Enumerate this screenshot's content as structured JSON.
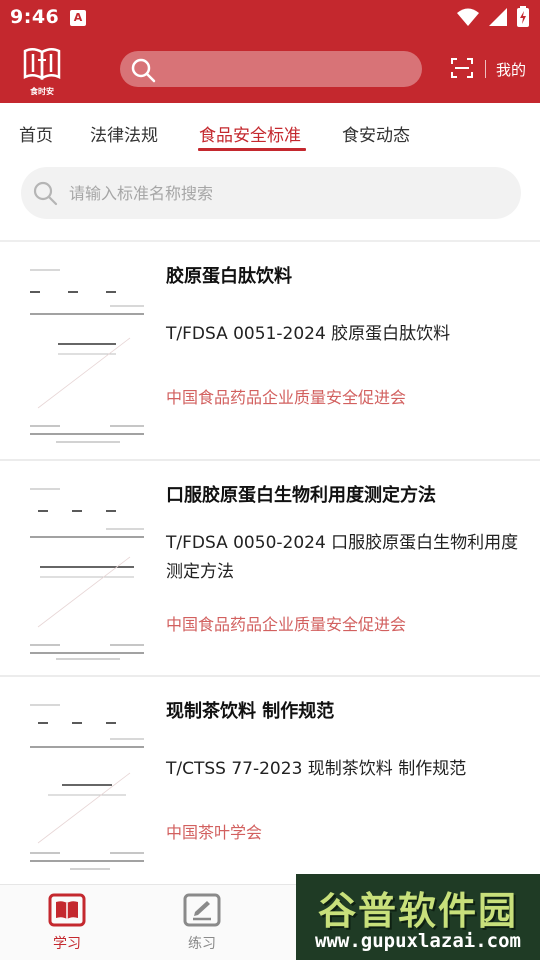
{
  "status_bar": {
    "time": "9:46",
    "notification_icon": "A"
  },
  "app_bar": {
    "logo_text": "食时安",
    "mine_label": "我的"
  },
  "tabs": [
    {
      "label": "首页"
    },
    {
      "label": "法律法规"
    },
    {
      "label": "食品安全标准"
    },
    {
      "label": "食安动态"
    }
  ],
  "active_tab": "食品安全标准",
  "standard_search": {
    "placeholder": "请输入标准名称搜索"
  },
  "items": [
    {
      "title": "胶原蛋白肽饮料",
      "code": "T/FDSA 0051-2024 胶原蛋白肽饮料",
      "org": "中国食品药品企业质量安全促进会"
    },
    {
      "title": "口服胶原蛋白生物利用度测定方法",
      "code": "T/FDSA 0050-2024 口服胶原蛋白生物利用度测定方法",
      "org": "中国食品药品企业质量安全促进会"
    },
    {
      "title": "现制茶饮料 制作规范",
      "code": "T/CTSS 77-2023 现制茶饮料 制作规范",
      "org": "中国茶叶学会"
    }
  ],
  "bottom_nav": [
    {
      "label": "学习",
      "icon": "book-icon",
      "active": true
    },
    {
      "label": "练习",
      "icon": "edit-icon",
      "active": false
    }
  ],
  "watermark": {
    "main": "谷普软件园",
    "url": "www.gupuxlazai.com"
  },
  "colors": {
    "brand_red": "#c4282e",
    "org_text": "#d2605f"
  }
}
